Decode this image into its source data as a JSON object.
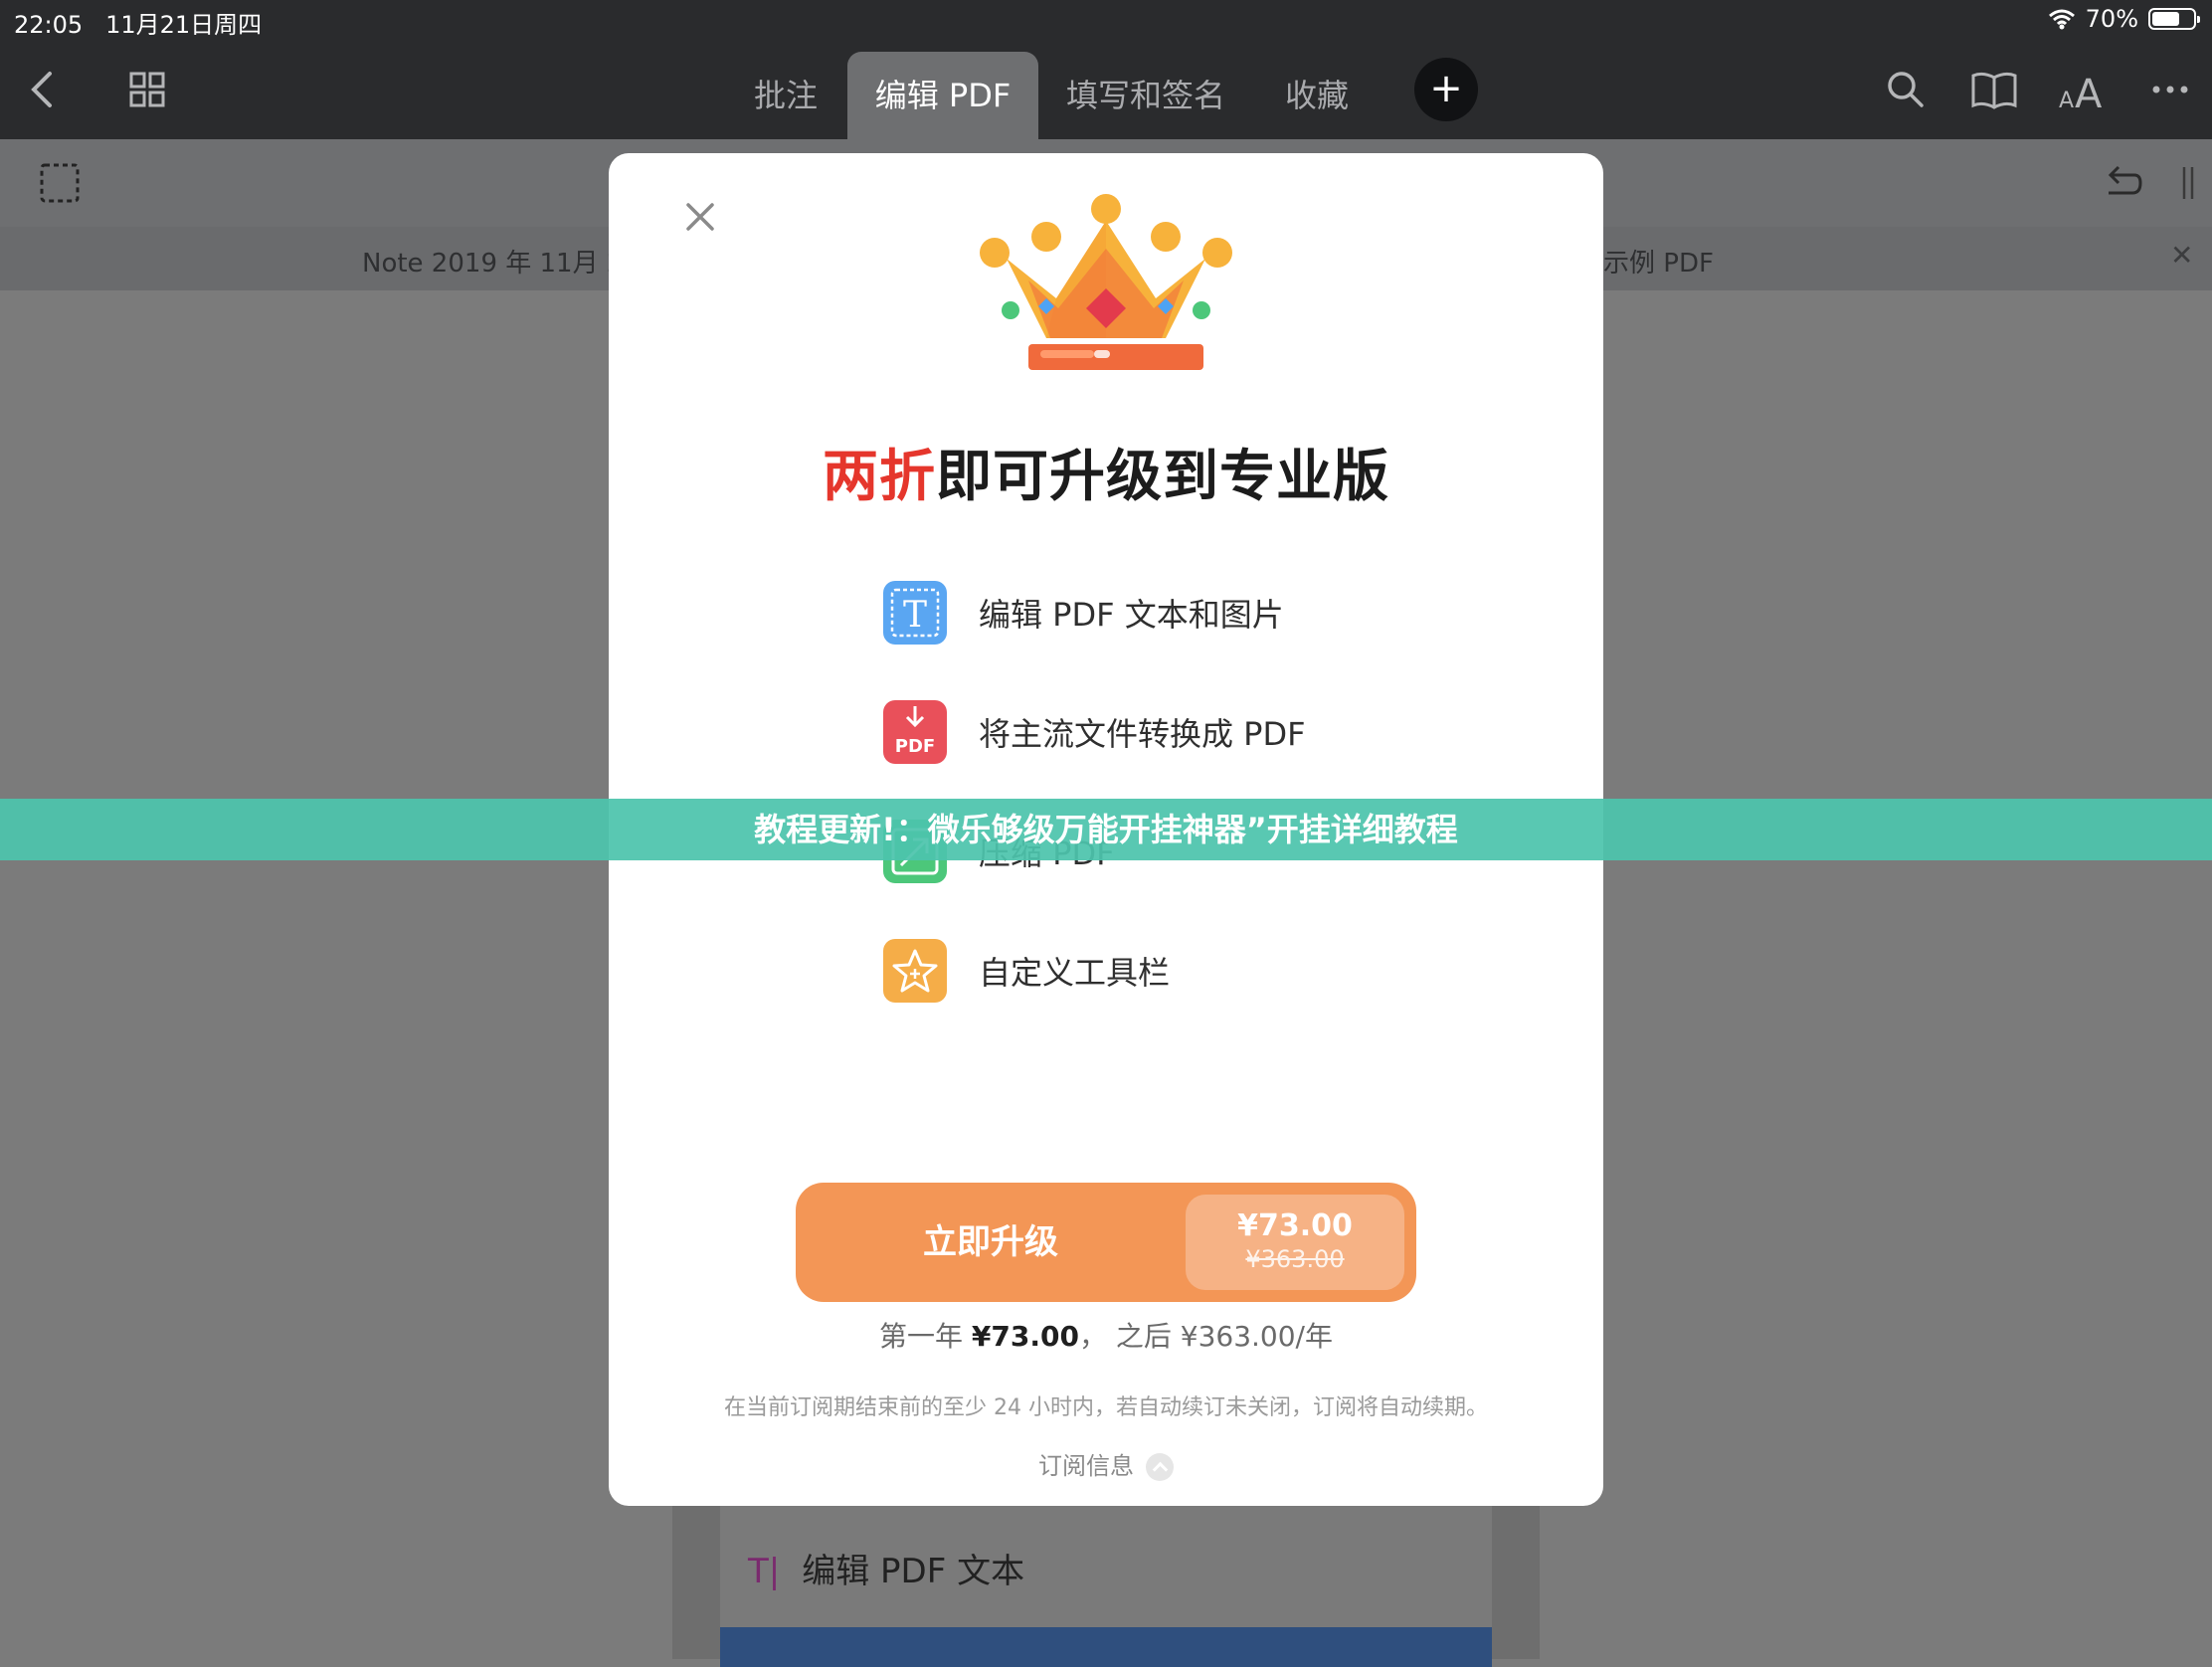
{
  "status": {
    "time": "22:05",
    "date": "11月21日周四",
    "battery": "70%",
    "battery_level": 0.7
  },
  "toolbar": {
    "tabs": [
      {
        "label": "批注"
      },
      {
        "label": "编辑 PDF"
      },
      {
        "label": "填写和签名"
      },
      {
        "label": "收藏"
      }
    ],
    "plus": "+"
  },
  "doc_tabs": {
    "left": "Note 2019 年 11月 21日",
    "right": "示例 PDF",
    "close": "✕"
  },
  "background_doc": {
    "line": "编辑 PDF 文本",
    "line_icon": "T|"
  },
  "modal": {
    "headline_highlight": "两折",
    "headline_rest": "即可升级到专业版",
    "features": [
      {
        "label": "编辑 PDF 文本和图片",
        "icon": "text-edit-icon",
        "color": "#5aa6f2"
      },
      {
        "label": "将主流文件转换成 PDF",
        "icon": "pdf-convert-icon",
        "color": "#e9505a"
      },
      {
        "label": "压缩 PDF",
        "icon": "compress-icon",
        "color": "#4cc77a"
      },
      {
        "label": "自定义工具栏",
        "icon": "star-icon",
        "color": "#f5ad48"
      }
    ],
    "cta": {
      "label": "立即升级",
      "price": "¥73.00",
      "original": "¥363.00"
    },
    "price_line": {
      "prefix": "第一年 ",
      "first_year": "¥73.00",
      "suffix": "， 之后 ¥363.00/年"
    },
    "terms": "在当前订阅期结束前的至少 24 小时内，若自动续订未关闭，订阅将自动续期。",
    "sub_info": "订阅信息"
  },
  "banner": "教程更新!：微乐够级万能开挂神器”开挂详细教程"
}
